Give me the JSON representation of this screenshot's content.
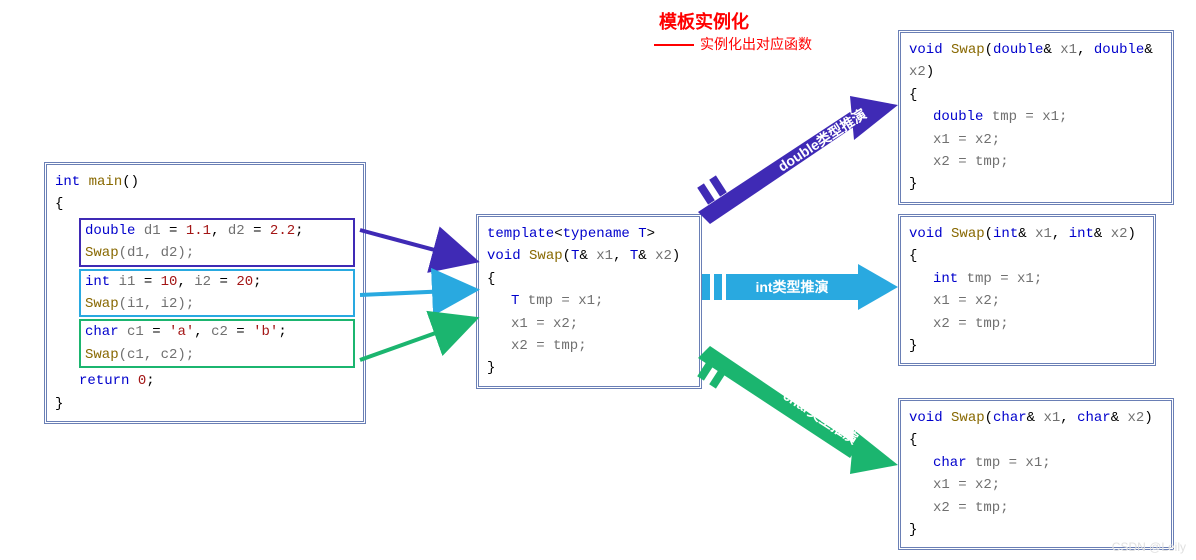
{
  "titles": {
    "main": "模板实例化",
    "sub": "实例化出对应函数"
  },
  "main_box": {
    "sig": {
      "kw": "int",
      "fn": "main",
      "rest": "()"
    },
    "decl_double": {
      "kw": "double",
      "d1n": "d1",
      "d1v": "1.1",
      "d2n": "d2",
      "d2v": "2.2"
    },
    "call_double": {
      "fn": "Swap",
      "args": "(d1, d2);"
    },
    "decl_int": {
      "kw": "int",
      "i1n": "i1",
      "i1v": "10",
      "i2n": "i2",
      "i2v": "20"
    },
    "call_int": {
      "fn": "Swap",
      "args": "(i1, i2);"
    },
    "decl_char": {
      "kw": "char",
      "c1n": "c1",
      "c1v": "'a'",
      "c2n": "c2",
      "c2v": "'b'"
    },
    "call_char": {
      "fn": "Swap",
      "args": "(c1, c2);"
    },
    "ret": {
      "kw": "return",
      "val": "0"
    }
  },
  "template_box": {
    "tmpl": {
      "kw": "template",
      "rest": "<",
      "kw2": "typename",
      "T": "T",
      "rest2": ">"
    },
    "sig": {
      "kw": "void",
      "fn": "Swap",
      "rest": "(",
      "T": "T",
      "amp": "&",
      "x1": "x1",
      "x2": "x2"
    },
    "line1": {
      "T": "T",
      "rest": " tmp = x1;"
    },
    "line2": "x1 = x2;",
    "line3": "x2 = tmp;"
  },
  "inst_double": {
    "sig": {
      "kw": "void",
      "fn": "Swap",
      "t": "double",
      "x1": "x1",
      "x2": "x2"
    },
    "line1": {
      "t": "double",
      "rest": " tmp = x1;"
    },
    "line2": "x1 = x2;",
    "line3": "x2 = tmp;"
  },
  "inst_int": {
    "sig": {
      "kw": "void",
      "fn": "Swap",
      "t": "int",
      "x1": "x1",
      "x2": "x2"
    },
    "line1": {
      "t": "int",
      "rest": " tmp = x1;"
    },
    "line2": "x1 = x2;",
    "line3": "x2 = tmp;"
  },
  "inst_char": {
    "sig": {
      "kw": "void",
      "fn": "Swap",
      "t": "char",
      "x1": "x1",
      "x2": "x2"
    },
    "line1": {
      "t": "char",
      "rest": " tmp = x1;"
    },
    "line2": "x1 = x2;",
    "line3": "x2 = tmp;"
  },
  "arrows": {
    "double_label": "double类型推演",
    "int_label": "int类型推演",
    "char_label": "char类型推演"
  },
  "watermark": "CSDN @Leily"
}
